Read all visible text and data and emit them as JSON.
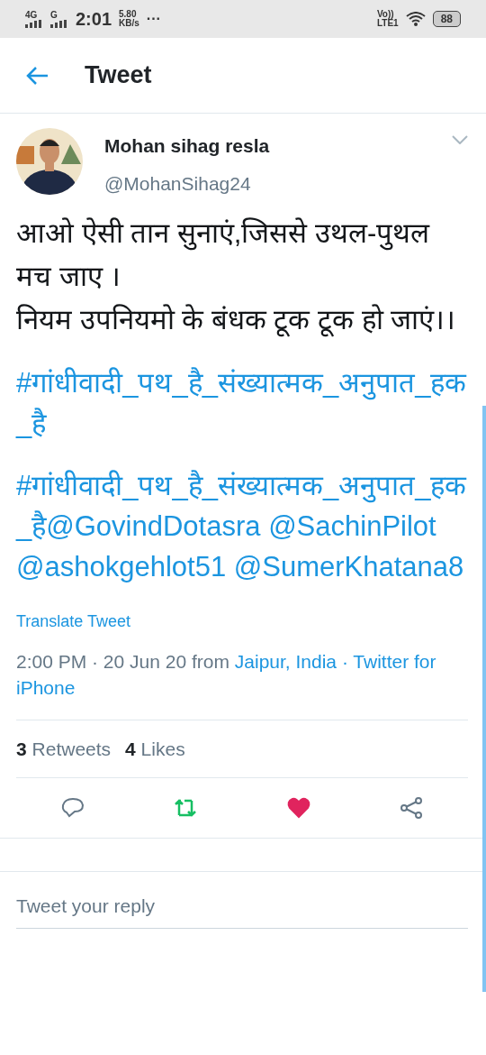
{
  "status_bar": {
    "network_1": "4G",
    "network_2": "G",
    "time": "2:01",
    "speed": "5.80",
    "speed_unit": "KB/s",
    "more": "···",
    "volte": "Vo))",
    "lte": "LTE1",
    "battery": "88"
  },
  "header": {
    "title": "Tweet"
  },
  "tweet": {
    "author": "Mohan sihag resla",
    "handle": "@MohanSihag24",
    "body": "आओ ऐसी तान सुनाएं,जिससे उथल-पुथल मच जाए ।\nनियम उपनियमो के बंधक टूक टूक हो जाएं।।",
    "paragraphs": [
      [
        {
          "kind": "hashtag",
          "text": "#गांधीवादी_पथ_है_संख्यात्मक_अनुपात_हक_है"
        }
      ],
      [
        {
          "kind": "hashtag",
          "text": "#गांधीवादी_पथ_है_संख्यात्मक_अनुपात_हक_है"
        },
        {
          "kind": "mention",
          "text": "@GovindDotasra"
        },
        {
          "kind": "mention",
          "text": "@SachinPilot"
        },
        {
          "kind": "mention",
          "text": "@ashokgehlot51"
        },
        {
          "kind": "mention",
          "text": "@SumerKhatana8"
        }
      ]
    ],
    "translate": "Translate Tweet",
    "meta": {
      "time": "2:00 PM · 20 Jun 20 from",
      "location": "Jaipur, India",
      "separator": "·",
      "source": "Twitter for iPhone"
    },
    "stats": [
      {
        "count": "3",
        "label": "Retweets"
      },
      {
        "count": "4",
        "label": "Likes"
      }
    ],
    "actions": [
      {
        "kind": "reply",
        "on": false
      },
      {
        "kind": "retweet",
        "on": true
      },
      {
        "kind": "like",
        "on": true
      },
      {
        "kind": "share",
        "on": false
      }
    ]
  },
  "reply": {
    "placeholder": "Tweet your reply"
  }
}
